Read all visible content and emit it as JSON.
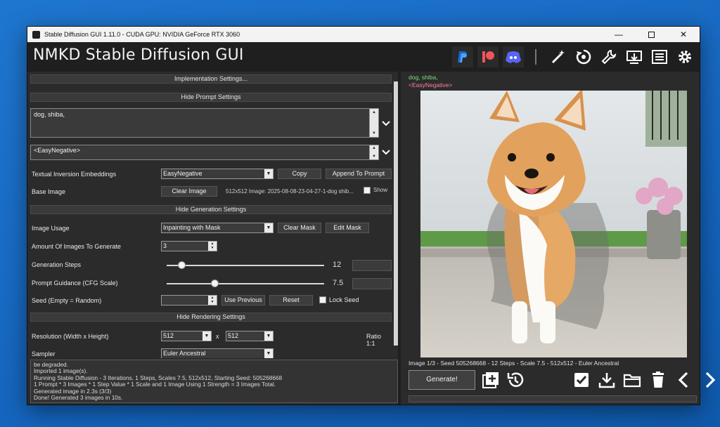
{
  "window": {
    "title": "Stable Diffusion GUI 1.11.0 - CUDA GPU: NVIDIA GeForce RTX 3060",
    "controls": [
      "minimize-icon",
      "maximize-icon",
      "close-icon"
    ]
  },
  "header": {
    "app_name": "NMKD Stable Diffusion GUI",
    "icons": [
      "paypal-icon",
      "patreon-icon",
      "discord-icon",
      "magic-wand-icon",
      "refresh-icon",
      "wrench-icon",
      "download-icon",
      "list-icon",
      "settings-gear-icon"
    ],
    "colors": {
      "paypal": "#1d63d6",
      "patreon": "#f0545d",
      "discord": "#5865f2"
    }
  },
  "sections": {
    "implementation": "Implementation Settings...",
    "prompt": "Hide Prompt Settings",
    "generation": "Hide Generation Settings",
    "rendering": "Hide Rendering Settings"
  },
  "prompt": {
    "positive": "dog, shiba,",
    "negative": "<EasyNegative>"
  },
  "fields": {
    "textual_inversion_label": "Textual Inversion Embeddings",
    "textual_inversion_value": "EasyNegative",
    "copy_btn": "Copy",
    "append_btn": "Append To Prompt",
    "base_image_label": "Base Image",
    "clear_image_btn": "Clear Image",
    "base_image_info": "512x512 Image: 2025-08-08-23-04-27-1-dog shib...",
    "show_label": "Show",
    "image_usage_label": "Image Usage",
    "image_usage_value": "Inpainting with Mask",
    "clear_mask_btn": "Clear Mask",
    "edit_mask_btn": "Edit Mask",
    "amount_label": "Amount Of Images To Generate",
    "amount_value": "3",
    "steps_label": "Generation Steps",
    "steps_value": "12",
    "steps_fraction": 0.1,
    "cfg_label": "Prompt Guidance (CFG Scale)",
    "cfg_value": "7.5",
    "cfg_fraction": 0.31,
    "seed_label": "Seed (Empty = Random)",
    "use_previous_btn": "Use Previous",
    "reset_btn": "Reset",
    "lock_seed_label": "Lock Seed",
    "resolution_label": "Resolution (Width x Height)",
    "width_value": "512",
    "x_sep": "x",
    "height_value": "512",
    "ratio_text": "Ratio 1:1",
    "sampler_label": "Sampler",
    "sampler_value": "Euler Ancestral"
  },
  "log": [
    "be degraded.",
    "Imported 1 image(s).",
    "Running Stable Diffusion - 3 Iterations, 1 Steps, Scales 7.5, 512x512, Starting Seed: 505268668",
    "1 Prompt * 3 Images * 1 Step Value * 1 Scale and 1 Image Using 1 Strength = 3 Images Total.",
    "Generated image in 2.3s (3/3)",
    "Done! Generated 3 images in 10s."
  ],
  "preview": {
    "prompt_line": "dog, shiba,",
    "negative_line": "<EasyNegative>",
    "status": "Image 1/3 - Seed 505268668 - 12 Steps - Scale 7.5 - 512x512 - Euler Ancestral",
    "generate_btn": "Generate!",
    "action_icons": [
      "add-image-icon",
      "history-icon",
      "check-box-icon",
      "save-download-icon",
      "folder-icon",
      "trash-icon",
      "prev-arrow-icon",
      "next-arrow-icon"
    ]
  }
}
